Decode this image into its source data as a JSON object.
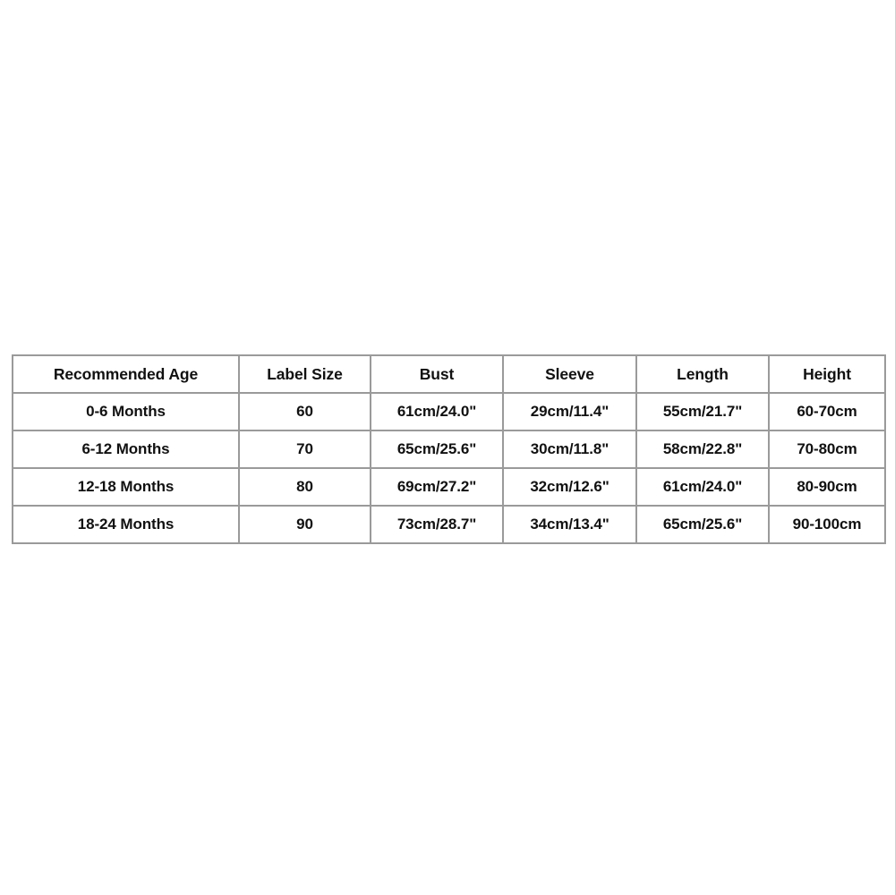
{
  "table": {
    "name": "baby-clothing-size-chart",
    "border_color": "#9a9a9a",
    "text_color": "#111111",
    "background_color": "#ffffff",
    "headers": [
      "Recommended Age",
      "Label Size",
      "Bust",
      "Sleeve",
      "Length",
      "Height"
    ],
    "rows": [
      {
        "age": "0-6 Months",
        "label_size": "60",
        "bust": "61cm/24.0\"",
        "sleeve": "29cm/11.4\"",
        "length": "55cm/21.7\"",
        "height": "60-70cm"
      },
      {
        "age": "6-12 Months",
        "label_size": "70",
        "bust": "65cm/25.6\"",
        "sleeve": "30cm/11.8\"",
        "length": "58cm/22.8\"",
        "height": "70-80cm"
      },
      {
        "age": "12-18 Months",
        "label_size": "80",
        "bust": "69cm/27.2\"",
        "sleeve": "32cm/12.6\"",
        "length": "61cm/24.0\"",
        "height": "80-90cm"
      },
      {
        "age": "18-24 Months",
        "label_size": "90",
        "bust": "73cm/28.7\"",
        "sleeve": "34cm/13.4\"",
        "length": "65cm/25.6\"",
        "height": "90-100cm"
      }
    ]
  }
}
